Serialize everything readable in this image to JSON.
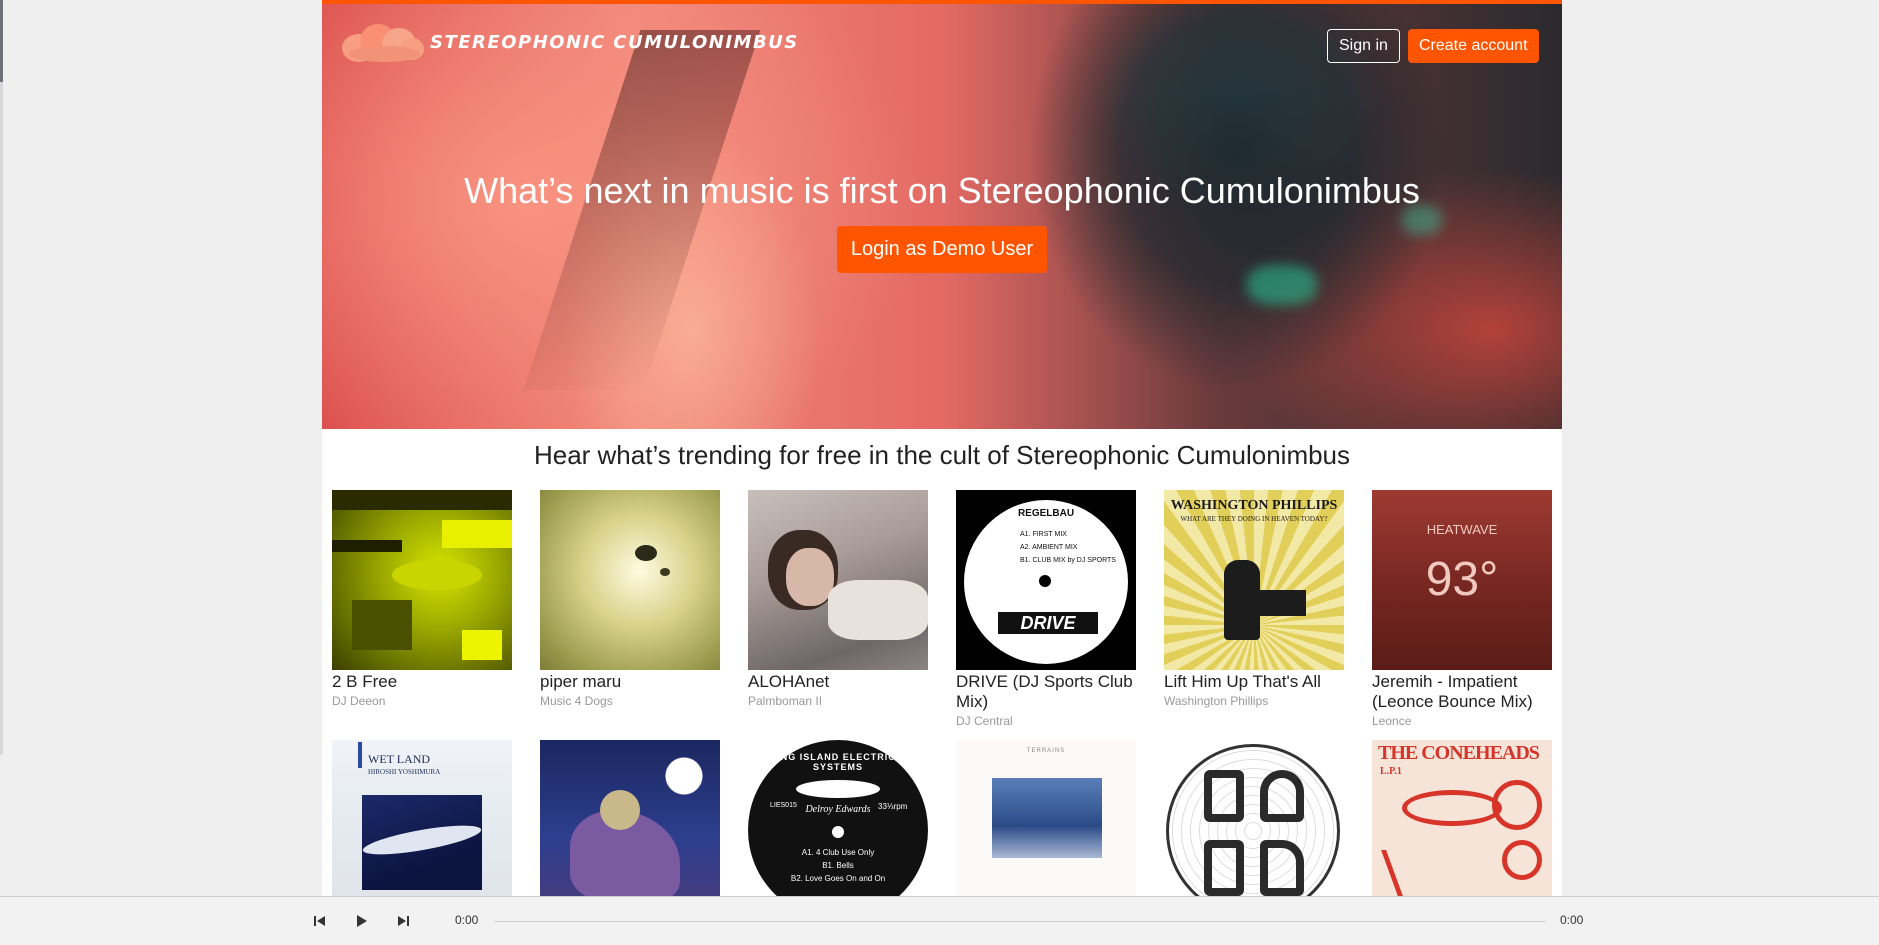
{
  "brand": {
    "name": "STEREOPHONIC CUMULONIMBUS",
    "accent": "#ff5500"
  },
  "header": {
    "sign_in_label": "Sign in",
    "create_account_label": "Create account"
  },
  "hero": {
    "headline": "What’s next in music is first on Stereophonic Cumulonimbus",
    "demo_button_label": "Login as Demo User"
  },
  "trending": {
    "title": "Hear what’s trending for free in the cult of Stereophonic Cumulonimbus",
    "tracks": [
      {
        "title": "2 B Free",
        "artist": "DJ Deeon"
      },
      {
        "title": "piper maru",
        "artist": "Music 4 Dogs"
      },
      {
        "title": "ALOHAnet",
        "artist": "Palmboman II"
      },
      {
        "title": "DRIVE (DJ Sports Club Mix)",
        "artist": "DJ Central"
      },
      {
        "title": "Lift Him Up That's All",
        "artist": "Washington Phillips"
      },
      {
        "title": "Jeremih - Impatient (Leonce Bounce Mix)",
        "artist": "Leonce"
      },
      {
        "title": "",
        "artist": ""
      },
      {
        "title": "",
        "artist": ""
      },
      {
        "title": "",
        "artist": ""
      },
      {
        "title": "",
        "artist": ""
      },
      {
        "title": "",
        "artist": ""
      },
      {
        "title": "",
        "artist": ""
      }
    ],
    "artwork_text": {
      "regelbau": "REGELBAU",
      "regelbau_tracks": [
        "A1. FIRST MIX",
        "A2. AMBIENT MIX",
        "B1. CLUB MIX by DJ SPORTS"
      ],
      "drive": "DRIVE",
      "washington": "WASHINGTON PHILLIPS",
      "washington_sub": "WHAT ARE THEY DOING IN HEAVEN TODAY?",
      "heatwave": "HEATWAVE",
      "heatwave_temp": "93°",
      "wetland": "WET LAND",
      "wetland_artist": "HIROSHI YOSHIMURA",
      "lies_ring": "LONG ISLAND ELECTRICAL SYSTEMS",
      "lies_artist": "Delroy Edwards",
      "lies_speed": "33⅓rpm",
      "lies_cat": "LIES015",
      "lies_tracks": [
        "A1. 4 Club Use Only",
        "B1. Bells",
        "B2. Love Goes On and On"
      ],
      "coneheads": "THE CONEHEADS",
      "coneheads_sub": "L.P.1",
      "terrace": "TERRAINS"
    }
  },
  "player": {
    "current_time": "0:00",
    "duration": "0:00",
    "progress": 0
  }
}
